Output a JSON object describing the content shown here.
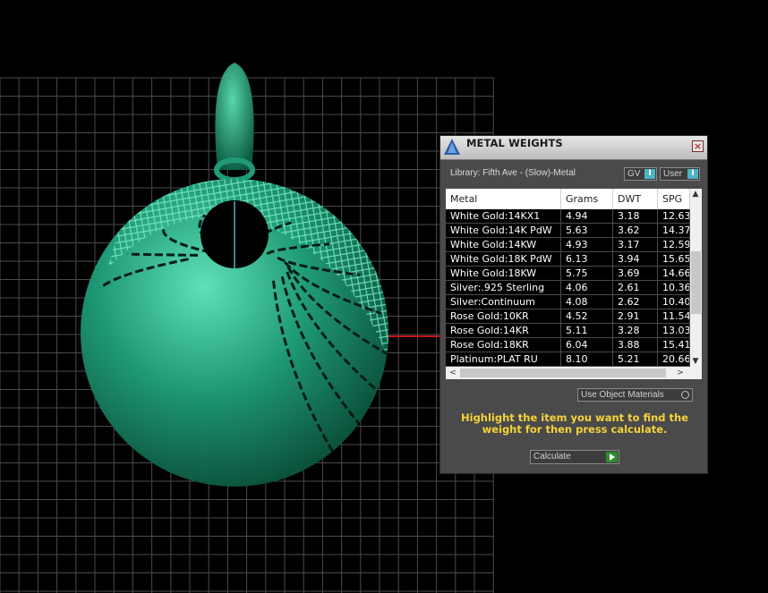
{
  "colors": {
    "model": "#1f9a76",
    "grid": "#4a4a4a",
    "accent": "#4cb3c4",
    "hint": "#f5d33a"
  },
  "panel": {
    "title": "METAL WEIGHTS",
    "close_icon": "close-icon",
    "library_label": "Library: Fifth Ave - (Slow)-Metal",
    "gv_label": "GV",
    "user_label": "User",
    "toggle_knob": "I",
    "columns": [
      "Metal",
      "Grams",
      "DWT",
      "SPG"
    ],
    "rows": [
      [
        "White Gold:14KX1",
        "4.94",
        "3.18",
        "12.63"
      ],
      [
        "White Gold:14K PdW",
        "5.63",
        "3.62",
        "14.37"
      ],
      [
        "White Gold:14KW",
        "4.93",
        "3.17",
        "12.59"
      ],
      [
        "White Gold:18K PdW",
        "6.13",
        "3.94",
        "15.65"
      ],
      [
        "White Gold:18KW",
        "5.75",
        "3.69",
        "14.66"
      ],
      [
        "Silver:.925 Sterling",
        "4.06",
        "2.61",
        "10.36"
      ],
      [
        "Silver:Continuum",
        "4.08",
        "2.62",
        "10.40"
      ],
      [
        "Rose Gold:10KR",
        "4.52",
        "2.91",
        "11.54"
      ],
      [
        "Rose Gold:14KR",
        "5.11",
        "3.28",
        "13.03"
      ],
      [
        "Rose Gold:18KR",
        "6.04",
        "3.88",
        "15.41"
      ],
      [
        "Platinum:PLAT RU",
        "8.10",
        "5.21",
        "20.66"
      ]
    ],
    "scroll_up": "▲",
    "scroll_down": "▼",
    "scroll_left": "<",
    "scroll_right": ">",
    "use_object_materials": "Use Object Materials",
    "hint": "Highlight the item you want to find the weight for then press calculate.",
    "calculate_label": "Calculate"
  }
}
